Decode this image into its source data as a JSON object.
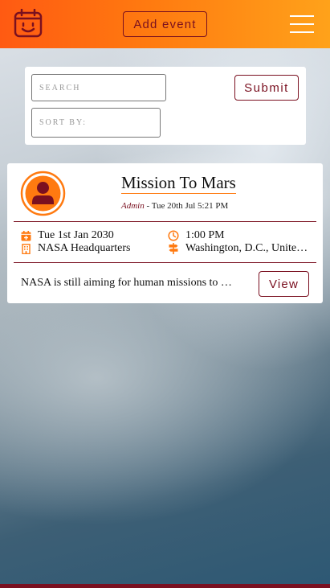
{
  "header": {
    "add_event_label": "Add event",
    "accent_color": "#ff7a10",
    "brand_color": "#7a1020",
    "icons": [
      "calendar-smile-icon",
      "hamburger-menu-icon"
    ]
  },
  "search": {
    "search_placeholder": "SEARCH",
    "sort_placeholder": "SORT BY:",
    "submit_label": "Submit"
  },
  "event": {
    "title": "Mission To Mars",
    "author": "Admin",
    "posted": " - Tue 20th Jul 5:21 PM",
    "date": "Tue 1st Jan 2030",
    "venue": "NASA Headquarters",
    "time": "1:00 PM",
    "location": "Washington, D.C., United States",
    "excerpt": "NASA is still aiming for human missions to Mars",
    "view_label": "View",
    "icons": [
      "user-avatar-icon",
      "calendar-plus-icon",
      "building-icon",
      "clock-icon",
      "signpost-icon"
    ]
  }
}
